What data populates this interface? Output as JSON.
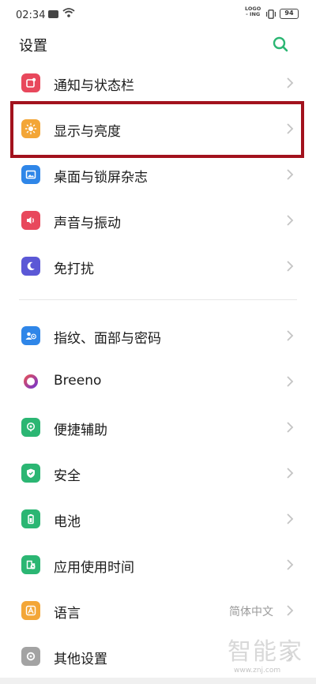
{
  "status_bar": {
    "time": "02:34",
    "logo_text_line1": "LOGO",
    "logo_text_line2": "ING",
    "battery": "94"
  },
  "header": {
    "title": "设置",
    "search_icon": "search-icon",
    "accent_color": "#2bb673"
  },
  "settings_items": [
    {
      "id": "notifications",
      "label": "通知与状态栏",
      "icon": "notification-icon",
      "color": "#e8485c"
    },
    {
      "id": "display",
      "label": "显示与亮度",
      "icon": "sun-icon",
      "color": "#f3a637"
    },
    {
      "id": "wallpaper",
      "label": "桌面与锁屏杂志",
      "icon": "picture-icon",
      "color": "#2f86e8"
    },
    {
      "id": "sound",
      "label": "声音与振动",
      "icon": "speaker-icon",
      "color": "#e8485c"
    },
    {
      "id": "dnd",
      "label": "免打扰",
      "icon": "moon-icon",
      "color": "#5b58d6"
    },
    {
      "id": "security-bio",
      "label": "指纹、面部与密码",
      "icon": "fingerprint-user-icon",
      "color": "#2f86e8"
    },
    {
      "id": "breeno",
      "label": "Breeno",
      "icon": "breeno-icon",
      "color": "#b33a9a"
    },
    {
      "id": "accessibility",
      "label": "便捷辅助",
      "icon": "accessibility-icon",
      "color": "#2bb673"
    },
    {
      "id": "safety",
      "label": "安全",
      "icon": "shield-icon",
      "color": "#2bb673"
    },
    {
      "id": "battery",
      "label": "电池",
      "icon": "battery-icon",
      "color": "#2bb673"
    },
    {
      "id": "screen-time",
      "label": "应用使用时间",
      "icon": "app-timer-icon",
      "color": "#2bb673"
    },
    {
      "id": "language",
      "label": "语言",
      "icon": "language-icon",
      "color": "#f3a637",
      "value": "简体中文"
    },
    {
      "id": "other",
      "label": "其他设置",
      "icon": "gear-icon",
      "color": "#a3a3a3"
    }
  ],
  "highlight_color": "#a2121d",
  "watermark": {
    "main": "智能家",
    "sub": "www.znj.com"
  }
}
